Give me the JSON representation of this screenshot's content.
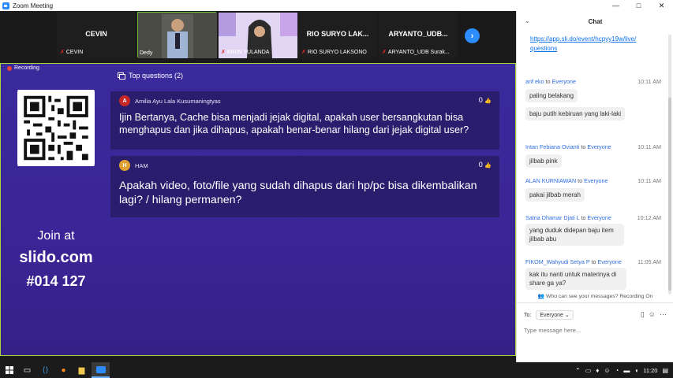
{
  "window": {
    "title": "Zoom Meeting",
    "controls": [
      "—",
      "□",
      "✕"
    ]
  },
  "participants": [
    {
      "big": "CEVIN",
      "name": "CEVIN",
      "muted": true,
      "video": false
    },
    {
      "big": "",
      "name": "Dedy",
      "muted": false,
      "video": true,
      "active": true
    },
    {
      "big": "",
      "name": "BIRIN YULANDA",
      "muted": true,
      "video": true
    },
    {
      "big": "RIO SURYO LAK...",
      "name": "RIO SURYO LAKSONO",
      "muted": true,
      "video": false
    },
    {
      "big": "ARYANTO_UDB...",
      "name": "ARYANTO_UDB Surak...",
      "muted": true,
      "video": false
    }
  ],
  "next_button": "›",
  "recording": "Recording",
  "slido": {
    "join_line1": "Join at",
    "join_line2": "slido.com",
    "join_line3": "#014 127",
    "top_questions": "Top questions (2)",
    "questions": [
      {
        "initial": "A",
        "avatar_color": "#c62828",
        "author": "Amilia Ayu Lala Kusumaningtyas",
        "likes": "0",
        "text": "Ijin Bertanya, Cache bisa menjadi jejak digital, apakah user bersangkutan bisa menghapus dan jika dihapus, apakah benar-benar hilang dari jejak digital user?"
      },
      {
        "initial": "H",
        "avatar_color": "#e0a030",
        "author": "HAM",
        "likes": "0",
        "text": "Apakah video, foto/file yang sudah dihapus dari hp/pc bisa dikembalikan lagi? / hilang permanen?"
      }
    ]
  },
  "chat": {
    "title": "Chat",
    "link": "https://app.sli.do/event/hcpyy19w/live/questions",
    "messages": [
      {
        "from": "arif eko",
        "to": "Everyone",
        "time": "10:11 AM",
        "bubbles": [
          "paling belakang",
          "baju putih kebiruan yang laki-laki"
        ]
      },
      {
        "from": "Intan Febiana Ovianti",
        "to": "Everyone",
        "time": "10:11 AM",
        "bubbles": [
          "jilbab pink"
        ]
      },
      {
        "from": "ALAN KURNIAWAN",
        "to": "Everyone",
        "time": "10:11 AM",
        "bubbles": [
          "pakai jilbab merah"
        ]
      },
      {
        "from": "Satria Dhamar Djati L",
        "to": "Everyone",
        "time": "10:12 AM",
        "bubbles": [
          "yang duduk didepan baju item jilbab abu"
        ]
      },
      {
        "from": "FIKOM_Wahyudi Setya P",
        "to": "Everyone",
        "time": "11:05 AM",
        "bubbles": [
          "kak itu nanti untuk materinya di share ga ya?"
        ]
      }
    ],
    "to_word": "to",
    "privacy_note": "Who can see your messages? Recording On",
    "to_label": "To:",
    "recipient": "Everyone",
    "placeholder": "Type message here..."
  },
  "taskbar": {
    "time": "11:20"
  }
}
